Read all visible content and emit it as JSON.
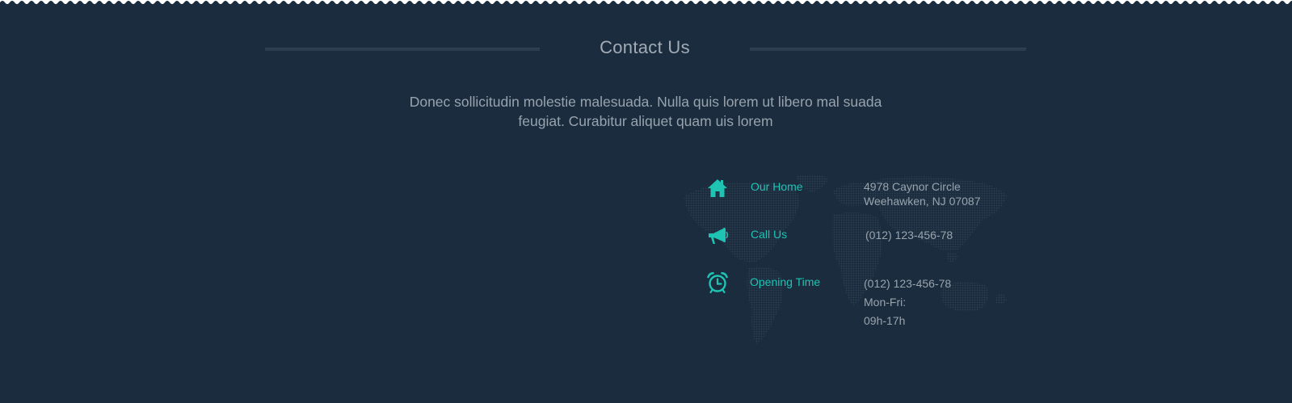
{
  "section": {
    "title": "Contact Us",
    "intro_line1": "Donec sollicitudin molestie malesuada. Nulla quis lorem ut libero mal suada",
    "intro_line2": "feugiat. Curabitur aliquet quam uis lorem"
  },
  "contact": {
    "home": {
      "icon": "home-icon",
      "label": "Our Home",
      "line1": "4978 Caynor Circle",
      "line2": "Weehawken, NJ 07087"
    },
    "call": {
      "icon": "megaphone-icon",
      "label": "Call Us",
      "line1": "(012) 123-456-78"
    },
    "hours": {
      "icon": "alarm-clock-icon",
      "label": "Opening Time",
      "line1": "(012) 123-456-78",
      "line2": "Mon-Fri:",
      "line3": "09h-17h"
    }
  },
  "colors": {
    "background": "#1a2c3d",
    "accent": "#1fc3b4",
    "heading": "#a3acb6",
    "body_text": "#98a3ae",
    "divider": "#2a3c4d"
  }
}
